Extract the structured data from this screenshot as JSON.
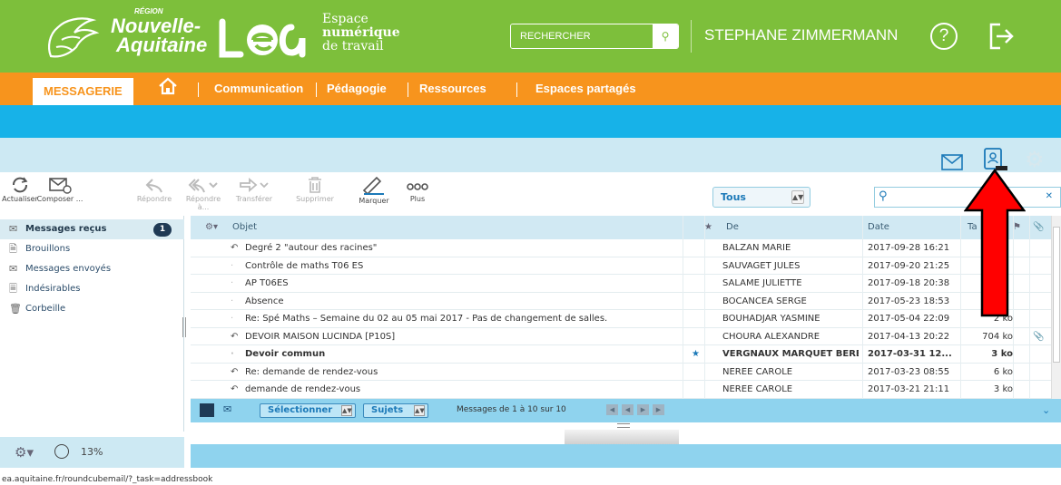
{
  "header": {
    "region_small": "RÉGION",
    "region_line1": "Nouvelle-",
    "region_line2": "Aquitaine",
    "lea_logo": "lea",
    "lea_sub1": "Espace",
    "lea_sub2": "numérique",
    "lea_sub3": "de travail",
    "search_label": "RECHERCHER",
    "user_name": "STEPHANE ZIMMERMANN",
    "help_glyph": "?",
    "colors": {
      "green": "#7dbf3b",
      "orange": "#f7941d",
      "blue": "#17b2e8"
    }
  },
  "nav": {
    "active": "MESSAGERIE",
    "items": [
      "Communication",
      "Pédagogie",
      "Ressources",
      "Espaces partagés"
    ]
  },
  "toolbar": {
    "refresh": "Actualiser",
    "compose": "Composer ...",
    "reply": "Répondre",
    "reply_all": "Répondre à...",
    "forward": "Transférer",
    "delete": "Supprimer",
    "mark": "Marquer",
    "more": "Plus",
    "filter_value": "Tous"
  },
  "folders": [
    {
      "label": "Messages reçus",
      "count": "1",
      "icon": "inbox-icon"
    },
    {
      "label": "Brouillons",
      "icon": "draft-icon"
    },
    {
      "label": "Messages envoyés",
      "icon": "sent-icon"
    },
    {
      "label": "Indésirables",
      "icon": "junk-icon"
    },
    {
      "label": "Corbeille",
      "icon": "trash-icon"
    }
  ],
  "quota": {
    "value": "13%"
  },
  "list": {
    "headers": {
      "subject": "Objet",
      "from": "De",
      "date": "Date",
      "size": "Ta"
    },
    "rows": [
      {
        "subject": "Degré 2 \"autour des racines\"",
        "from": "BALZAN MARIE",
        "date": "2017-09-28 16:21",
        "size": "",
        "replied": true,
        "bold": false,
        "flag": false,
        "att": false
      },
      {
        "subject": "Contrôle de maths T06 ES",
        "from": "SAUVAGET JULES",
        "date": "2017-09-20 21:25",
        "size": "",
        "replied": false,
        "bold": false,
        "flag": false,
        "att": false
      },
      {
        "subject": "AP T06ES",
        "from": "SALAME JULIETTE",
        "date": "2017-09-18 20:38",
        "size": "",
        "replied": false,
        "bold": false,
        "flag": false,
        "att": false
      },
      {
        "subject": "Absence",
        "from": "BOCANCEA SERGE",
        "date": "2017-05-23 18:53",
        "size": "",
        "replied": false,
        "bold": false,
        "flag": false,
        "att": false
      },
      {
        "subject": "Re: Spé Maths – Semaine du 02 au 05 mai 2017 - Pas de changement de salles.",
        "from": "BOUHADJAR YASMINE",
        "date": "2017-05-04 22:09",
        "size": "2 ko",
        "replied": false,
        "bold": false,
        "flag": false,
        "att": false
      },
      {
        "subject": "DEVOIR MAISON LUCINDA [P10S]",
        "from": "CHOURA ALEXANDRE",
        "date": "2017-04-13 20:22",
        "size": "704 ko",
        "replied": true,
        "bold": false,
        "flag": false,
        "att": true
      },
      {
        "subject": "Devoir commun",
        "from": "VERGNAUX MARQUET BERE...",
        "date": "2017-03-31 12...",
        "size": "3 ko",
        "replied": false,
        "bold": true,
        "flag": true,
        "att": false
      },
      {
        "subject": "Re: demande de rendez-vous",
        "from": "NEREE CAROLE",
        "date": "2017-03-23 08:55",
        "size": "6 ko",
        "replied": true,
        "bold": false,
        "flag": false,
        "att": false
      },
      {
        "subject": "demande de rendez-vous",
        "from": "NEREE CAROLE",
        "date": "2017-03-21 21:11",
        "size": "3 ko",
        "replied": true,
        "bold": false,
        "flag": false,
        "att": false
      }
    ]
  },
  "footer": {
    "select_label": "Sélectionner",
    "threads_label": "Sujets",
    "count_text": "Messages de 1 à 10 sur 10"
  },
  "status_url": "ea.aquitaine.fr/roundcubemail/?_task=addressbook"
}
